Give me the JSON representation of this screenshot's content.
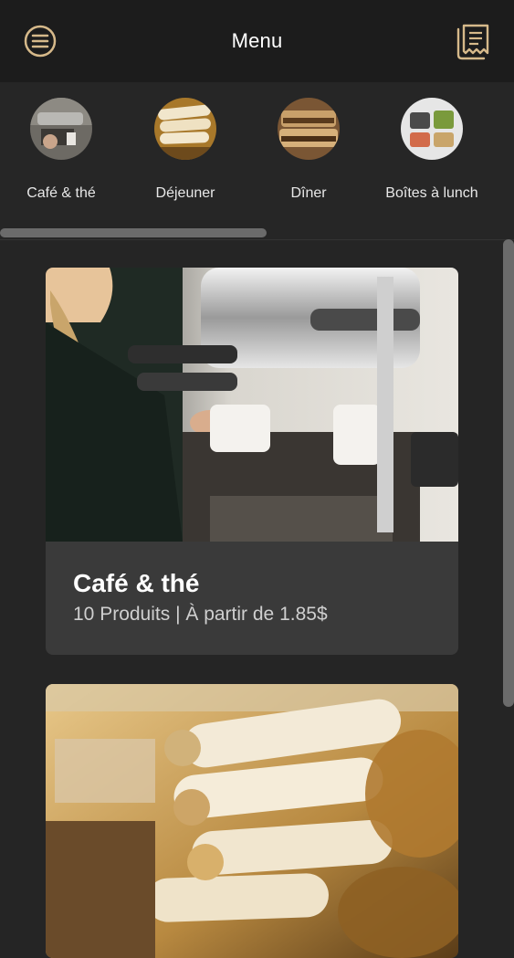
{
  "header": {
    "title": "Menu"
  },
  "categories": [
    {
      "label": "Café & thé"
    },
    {
      "label": "Déjeuner"
    },
    {
      "label": "Dîner"
    },
    {
      "label": "Boîtes à lunch"
    }
  ],
  "cards": [
    {
      "name": "Café & thé",
      "meta": "10 Produits | À partir de 1.85$"
    }
  ],
  "colors": {
    "accent": "#d6b98a",
    "background": "#252525",
    "topbar": "#1c1c1c",
    "card": "#3a3a3a"
  }
}
